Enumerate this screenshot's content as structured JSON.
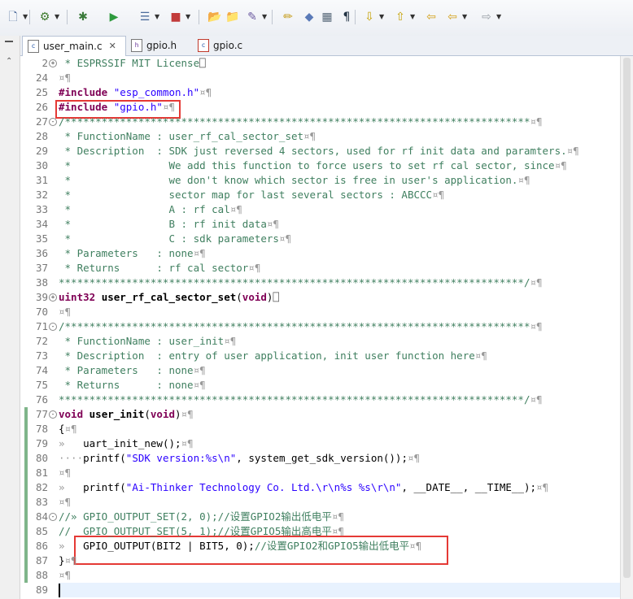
{
  "toolbar": {
    "items": [
      {
        "name": "new-file-icon",
        "glyph": "🗋",
        "color": "#4a6a9a"
      },
      {
        "name": "build-icon",
        "glyph": "⚙",
        "color": "#3c7a2c"
      },
      {
        "name": "debug-icon",
        "glyph": "✱",
        "color": "#3a7a3a"
      },
      {
        "name": "run-icon",
        "glyph": "▶",
        "color": "#2e9a3e"
      },
      {
        "name": "external-tools-icon",
        "glyph": "☰",
        "color": "#4c6c9c"
      },
      {
        "name": "stop-icon",
        "glyph": "■",
        "color": "#c23b3b"
      },
      {
        "name": "open-folder-icon",
        "glyph": "📂",
        "color": "#c9a227"
      },
      {
        "name": "open-type-icon",
        "glyph": "📁",
        "color": "#c9a227"
      },
      {
        "name": "search-icon",
        "glyph": "✎",
        "color": "#6b5aa0"
      },
      {
        "name": "highlight-icon",
        "glyph": "✏",
        "color": "#c59a16"
      },
      {
        "name": "mark-occurrences-icon",
        "glyph": "◆",
        "color": "#5a7ab8"
      },
      {
        "name": "block-selection-icon",
        "glyph": "▦",
        "color": "#556677"
      },
      {
        "name": "show-whitespace-icon",
        "glyph": "¶",
        "color": "#223344"
      },
      {
        "name": "next-annotation-icon",
        "glyph": "⇩",
        "color": "#c5a000"
      },
      {
        "name": "prev-annotation-icon",
        "glyph": "⇧",
        "color": "#c5a000"
      },
      {
        "name": "last-edit-icon",
        "glyph": "⇦",
        "color": "#d4a017"
      },
      {
        "name": "back-icon",
        "glyph": "⇦",
        "color": "#d4a017"
      },
      {
        "name": "forward-icon",
        "glyph": "⇨",
        "color": "#9aa0a8"
      }
    ]
  },
  "tabs": [
    {
      "label": "user_main.c",
      "icon": "c"
    },
    {
      "label": "gpio.h",
      "icon": "h"
    },
    {
      "label": "gpio.c",
      "icon": "c"
    }
  ],
  "colors": {
    "comment": "#3f7f5f",
    "keyword": "#7f0055",
    "string": "#2a00ff",
    "line_number": "#787878",
    "highlight_box": "#e53935",
    "current_line": "#e8f2fe"
  },
  "editor": {
    "lines": [
      {
        "n": "2",
        "fold": "+",
        "segs": [
          [
            "comment",
            " * ESPRSSIF MIT License"
          ],
          [
            "box",
            "⎕"
          ]
        ]
      },
      {
        "n": "24",
        "segs": [
          [
            "ws",
            "¤¶"
          ]
        ]
      },
      {
        "n": "25",
        "segs": [
          [
            "pre",
            "#include "
          ],
          [
            "str",
            "\"esp_common.h\""
          ],
          [
            "ws",
            "¤¶"
          ]
        ]
      },
      {
        "n": "26",
        "segs": [
          [
            "pre",
            "#include "
          ],
          [
            "str",
            "\"gpio.h\""
          ],
          [
            "ws",
            "¤¶"
          ]
        ]
      },
      {
        "n": "27",
        "fold": "-",
        "segs": [
          [
            "comment",
            "/****************************************************************************"
          ],
          [
            "ws",
            "¤¶"
          ]
        ]
      },
      {
        "n": "28",
        "segs": [
          [
            "comment",
            " * FunctionName : user_rf_cal_sector_set"
          ],
          [
            "ws",
            "¤¶"
          ]
        ]
      },
      {
        "n": "29",
        "segs": [
          [
            "comment",
            " * Description  : SDK just reversed 4 sectors, used for rf init data and paramters."
          ],
          [
            "ws",
            "¤¶"
          ]
        ]
      },
      {
        "n": "30",
        "segs": [
          [
            "comment",
            " *                We add this function to force users to set rf cal sector, since"
          ],
          [
            "ws",
            "¤¶"
          ]
        ]
      },
      {
        "n": "31",
        "segs": [
          [
            "comment",
            " *                we don't know which sector is free in user's application."
          ],
          [
            "ws",
            "¤¶"
          ]
        ]
      },
      {
        "n": "32",
        "segs": [
          [
            "comment",
            " *                sector map for last several sectors : ABCCC"
          ],
          [
            "ws",
            "¤¶"
          ]
        ]
      },
      {
        "n": "33",
        "segs": [
          [
            "comment",
            " *                A : rf cal"
          ],
          [
            "ws",
            "¤¶"
          ]
        ]
      },
      {
        "n": "34",
        "segs": [
          [
            "comment",
            " *                B : rf init data"
          ],
          [
            "ws",
            "¤¶"
          ]
        ]
      },
      {
        "n": "35",
        "segs": [
          [
            "comment",
            " *                C : sdk parameters"
          ],
          [
            "ws",
            "¤¶"
          ]
        ]
      },
      {
        "n": "36",
        "segs": [
          [
            "comment",
            " * Parameters   : none"
          ],
          [
            "ws",
            "¤¶"
          ]
        ]
      },
      {
        "n": "37",
        "segs": [
          [
            "comment",
            " * Returns      : rf cal sector"
          ],
          [
            "ws",
            "¤¶"
          ]
        ]
      },
      {
        "n": "38",
        "segs": [
          [
            "comment",
            "****************************************************************************/"
          ],
          [
            "ws",
            "¤¶"
          ]
        ]
      },
      {
        "n": "39",
        "fold": "+",
        "segs": [
          [
            "key",
            "uint32 "
          ],
          [
            "fn",
            "user_rf_cal_sector_set"
          ],
          [
            "plain",
            "("
          ],
          [
            "key",
            "void"
          ],
          [
            "plain",
            ")"
          ],
          [
            "box",
            "⎕"
          ]
        ]
      },
      {
        "n": "70",
        "segs": [
          [
            "ws",
            "¤¶"
          ]
        ]
      },
      {
        "n": "71",
        "fold": "-",
        "segs": [
          [
            "comment",
            "/****************************************************************************"
          ],
          [
            "ws",
            "¤¶"
          ]
        ]
      },
      {
        "n": "72",
        "segs": [
          [
            "comment",
            " * FunctionName : user_init"
          ],
          [
            "ws",
            "¤¶"
          ]
        ]
      },
      {
        "n": "73",
        "segs": [
          [
            "comment",
            " * Description  : entry of user application, init user function here"
          ],
          [
            "ws",
            "¤¶"
          ]
        ]
      },
      {
        "n": "74",
        "segs": [
          [
            "comment",
            " * Parameters   : none"
          ],
          [
            "ws",
            "¤¶"
          ]
        ]
      },
      {
        "n": "75",
        "segs": [
          [
            "comment",
            " * Returns      : none"
          ],
          [
            "ws",
            "¤¶"
          ]
        ]
      },
      {
        "n": "76",
        "segs": [
          [
            "comment",
            "****************************************************************************/"
          ],
          [
            "ws",
            "¤¶"
          ]
        ]
      },
      {
        "n": "77",
        "fold": "-",
        "segs": [
          [
            "key",
            "void "
          ],
          [
            "fn",
            "user_init"
          ],
          [
            "plain",
            "("
          ],
          [
            "key",
            "void"
          ],
          [
            "plain",
            ")"
          ],
          [
            "ws",
            "¤¶"
          ]
        ]
      },
      {
        "n": "78",
        "segs": [
          [
            "plain",
            "{"
          ],
          [
            "ws",
            "¤¶"
          ]
        ]
      },
      {
        "n": "79",
        "segs": [
          [
            "ws",
            "»   "
          ],
          [
            "plain",
            "uart_init_new();"
          ],
          [
            "ws",
            "¤¶"
          ]
        ]
      },
      {
        "n": "80",
        "segs": [
          [
            "ws",
            "····"
          ],
          [
            "plain",
            "printf("
          ],
          [
            "str",
            "\"SDK version:%s\\n\""
          ],
          [
            "plain",
            ", system_get_sdk_version());"
          ],
          [
            "ws",
            "¤¶"
          ]
        ]
      },
      {
        "n": "81",
        "segs": [
          [
            "ws",
            "¤¶"
          ]
        ]
      },
      {
        "n": "82",
        "segs": [
          [
            "ws",
            "»   "
          ],
          [
            "plain",
            "printf("
          ],
          [
            "str",
            "\"Ai-Thinker Technology Co. Ltd.\\r\\n%s %s\\r\\n\""
          ],
          [
            "plain",
            ", __DATE__, __TIME__);"
          ],
          [
            "ws",
            "¤¶"
          ]
        ]
      },
      {
        "n": "83",
        "segs": [
          [
            "ws",
            "¤¶"
          ]
        ]
      },
      {
        "n": "84",
        "fold": "-",
        "segs": [
          [
            "comment",
            "//» GPIO_OUTPUT_SET(2, 0);//设置GPIO2输出低电平"
          ],
          [
            "ws",
            "¤¶"
          ]
        ]
      },
      {
        "n": "85",
        "segs": [
          [
            "comment",
            "//  GPIO_OUTPUT_SET(5, 1);//设置GPIO5输出高电平"
          ],
          [
            "ws",
            "¤¶"
          ]
        ]
      },
      {
        "n": "86",
        "segs": [
          [
            "ws",
            "»   "
          ],
          [
            "plain",
            "GPIO_OUTPUT(BIT2 | BIT5, 0);"
          ],
          [
            "comment",
            "//设置GPIO2和GPIO5输出低电平"
          ],
          [
            "ws",
            "¤¶"
          ]
        ]
      },
      {
        "n": "87",
        "segs": [
          [
            "plain",
            "}"
          ],
          [
            "ws",
            "¤¶"
          ]
        ]
      },
      {
        "n": "88",
        "segs": [
          [
            "ws",
            "¤¶"
          ]
        ]
      },
      {
        "n": "89",
        "segs": []
      }
    ]
  }
}
